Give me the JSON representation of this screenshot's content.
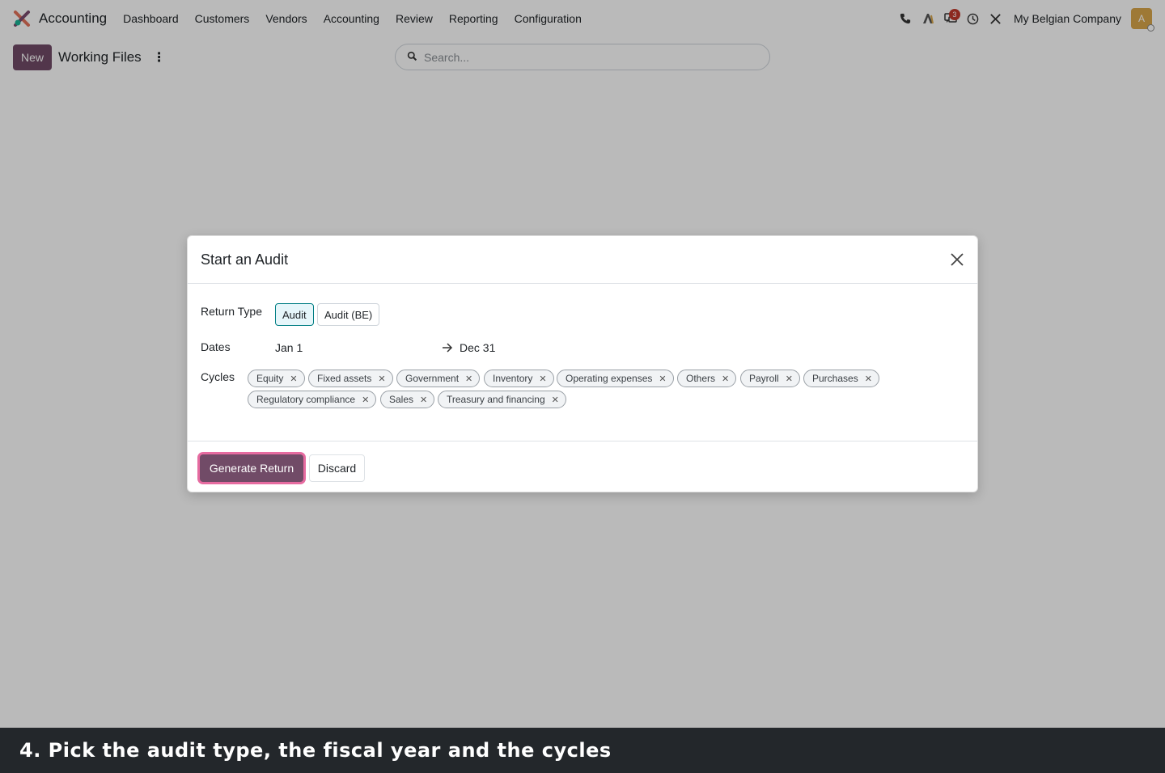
{
  "navbar": {
    "app_name": "Accounting",
    "menu": [
      "Dashboard",
      "Customers",
      "Vendors",
      "Accounting",
      "Review",
      "Reporting",
      "Configuration"
    ],
    "messages_badge": "3",
    "company": "My Belgian Company",
    "avatar_initial": "A"
  },
  "control": {
    "new_label": "New",
    "title": "Working Files",
    "search_placeholder": "Search..."
  },
  "dialog": {
    "title": "Start an Audit",
    "return_type_label": "Return Type",
    "return_types": [
      "Audit",
      "Audit (BE)"
    ],
    "selected_return_type": "Audit",
    "dates_label": "Dates",
    "date_from": "Jan 1",
    "date_to": "Dec 31",
    "cycles_label": "Cycles",
    "cycles": [
      "Equity",
      "Fixed assets",
      "Government",
      "Inventory",
      "Operating expenses",
      "Others",
      "Payroll",
      "Purchases",
      "Regulatory compliance",
      "Sales",
      "Treasury and financing"
    ],
    "generate_label": "Generate Return",
    "discard_label": "Discard"
  },
  "caption": {
    "text": "4. Pick the audit type, the fiscal year and the cycles"
  },
  "colors": {
    "primary": "#714B67",
    "highlight": "#e66ba0",
    "caption_bg": "#23272b"
  }
}
